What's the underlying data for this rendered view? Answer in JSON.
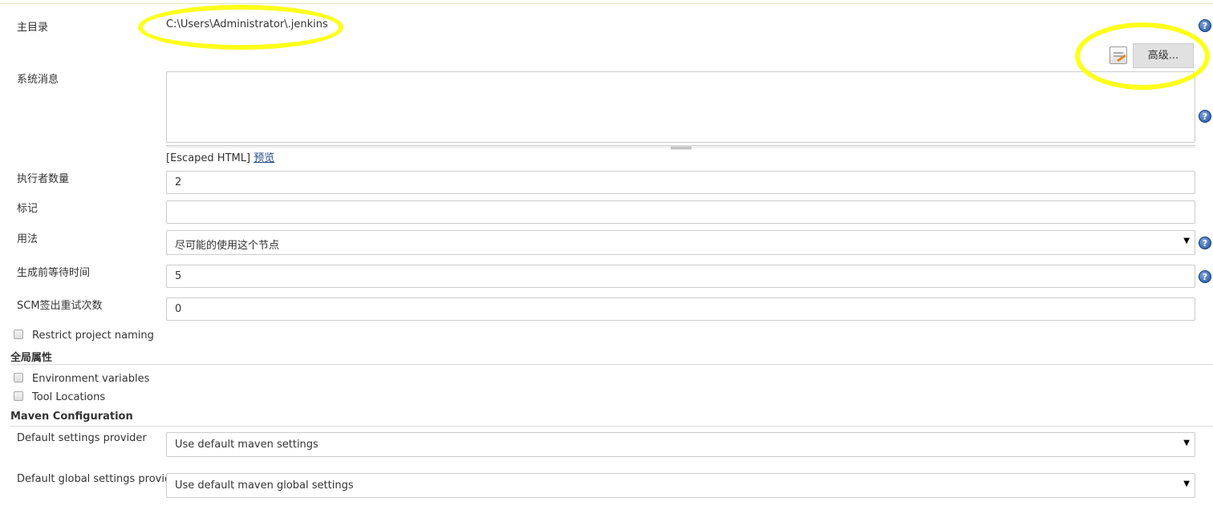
{
  "form": {
    "home_dir": {
      "label": "主目录",
      "value": "C:\\Users\\Administrator\\.jenkins"
    },
    "advanced_button": "高级...",
    "system_message": {
      "label": "系统消息",
      "value": "",
      "escaped_html": "[Escaped HTML]",
      "preview_link": "预览"
    },
    "executors": {
      "label": "执行者数量",
      "value": "2"
    },
    "labels": {
      "label": "标记",
      "value": ""
    },
    "usage": {
      "label": "用法",
      "value": "尽可能的使用这个节点"
    },
    "quiet_period": {
      "label": "生成前等待时间",
      "value": "5"
    },
    "scm_retry": {
      "label": "SCM签出重试次数",
      "value": "0"
    },
    "restrict_naming": "Restrict project naming",
    "global_properties": {
      "title": "全局属性",
      "env_vars": "Environment variables",
      "tool_locations": "Tool Locations"
    },
    "maven": {
      "title": "Maven Configuration",
      "settings": {
        "label": "Default settings provider",
        "value": "Use default maven settings"
      },
      "global_settings": {
        "label": "Default global settings provider",
        "value": "Use default maven global settings"
      }
    }
  },
  "help_icon": "?",
  "dropdown_arrow": "▼",
  "annotation_color": "#ffff1a"
}
